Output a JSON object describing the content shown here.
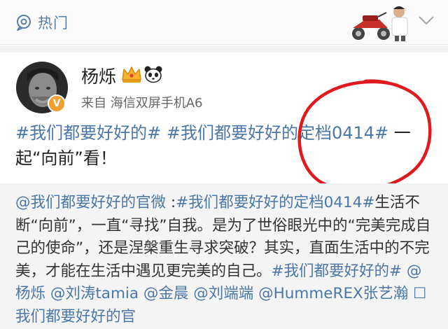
{
  "header": {
    "hot_label": "热门",
    "hot_icon": "location-pin-icon",
    "banner_icon": "promo-banner-illustration",
    "dropdown_icon": "chevron-down-icon"
  },
  "post": {
    "author": "杨烁",
    "source": "来自 海信双屏手机A6",
    "verified_badge": "V",
    "badges": [
      "crown-icon",
      "panda-icon"
    ],
    "segments": [
      {
        "type": "tag",
        "text": "#我们都要好好的#"
      },
      {
        "type": "text",
        "text": " "
      },
      {
        "type": "tag",
        "text": "#我们都要好好的定档0414#"
      },
      {
        "type": "text",
        "text": " 一起“向前”看！"
      }
    ]
  },
  "retweet": {
    "segments": [
      {
        "type": "link",
        "text": "@我们都要好好的官微"
      },
      {
        "type": "text",
        "text": " :"
      },
      {
        "type": "link",
        "text": "#我们都要好好的定档0414#"
      },
      {
        "type": "text",
        "text": "生活不断“向前”，一直“寻找”自我。是为了世俗眼光中的“完美完成自己的使命”，还是涅槃重生寻求突破？其实，直面生活中的不完美，才能在生活中遇见更完美的自己。"
      },
      {
        "type": "link",
        "text": "#我们都要好好的#"
      },
      {
        "type": "text",
        "text": " "
      },
      {
        "type": "link",
        "text": "@杨烁"
      },
      {
        "type": "text",
        "text": " "
      },
      {
        "type": "link",
        "text": "@刘涛tamia"
      },
      {
        "type": "text",
        "text": " "
      },
      {
        "type": "link",
        "text": "@金晨"
      },
      {
        "type": "text",
        "text": " "
      },
      {
        "type": "link",
        "text": "@刘端端"
      },
      {
        "type": "text",
        "text": " "
      },
      {
        "type": "link",
        "text": "@HummeREX张艺瀚"
      },
      {
        "type": "text",
        "text": " "
      },
      {
        "type": "link",
        "text": "☐我们都要好好的官"
      }
    ]
  },
  "colors": {
    "link": "#4b77a8",
    "annotation": "#e0191e",
    "vip_badge": "#f0a030"
  }
}
